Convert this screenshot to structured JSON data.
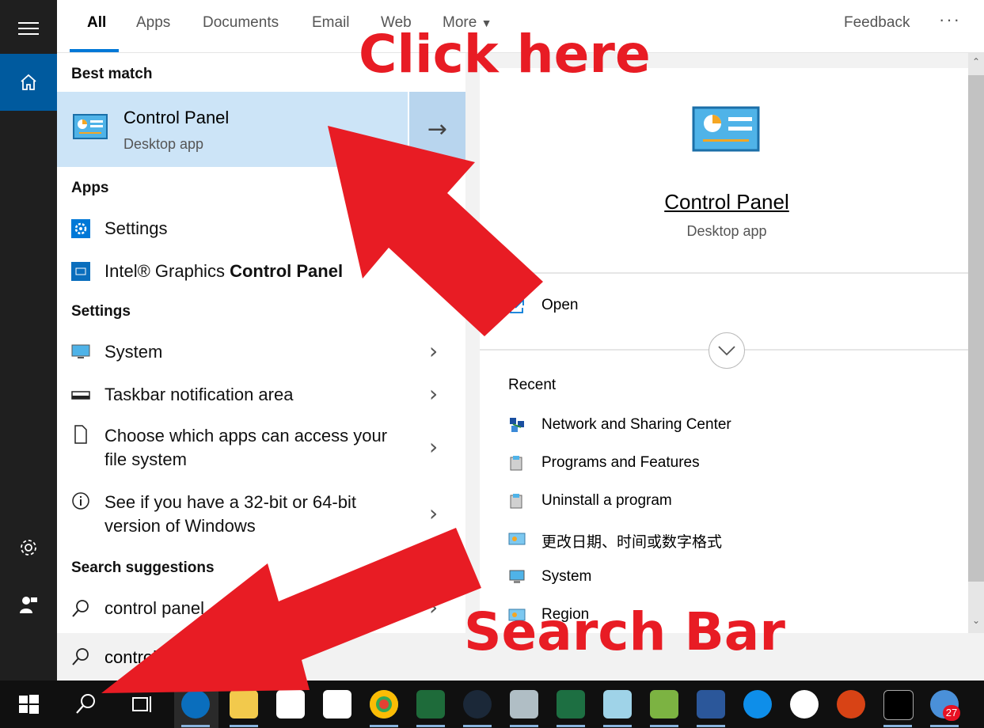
{
  "tabs": [
    {
      "label": "All",
      "active": true
    },
    {
      "label": "Apps"
    },
    {
      "label": "Documents"
    },
    {
      "label": "Email"
    },
    {
      "label": "Web"
    },
    {
      "label": "More"
    }
  ],
  "feedback_label": "Feedback",
  "more_options_label": "···",
  "sections": {
    "best_match": "Best match",
    "apps": "Apps",
    "settings": "Settings",
    "search_suggestions": "Search suggestions"
  },
  "best_match": {
    "title": "Control Panel",
    "subtitle": "Desktop app"
  },
  "apps": [
    {
      "label": "Settings"
    },
    {
      "label_prefix": "Intel® Graphics ",
      "label_bold": "Control Panel"
    }
  ],
  "settings_items": [
    {
      "line1": "System",
      "line2": ""
    },
    {
      "line1": "Taskbar notification area",
      "line2": ""
    },
    {
      "line1": "Choose which apps can access your",
      "line2": "file system"
    },
    {
      "line1": "See if you have a 32-bit or 64-bit",
      "line2": "version of Windows"
    }
  ],
  "suggestion": "control panel",
  "search_query": "control",
  "preview": {
    "title": "Control Panel",
    "subtitle": "Desktop app",
    "open_label": "Open",
    "recent_label": "Recent",
    "recent": [
      "Network and Sharing Center",
      "Programs and Features",
      "Uninstall a program",
      "更改日期、时间或数字格式",
      "System",
      "Region"
    ]
  },
  "annotations": {
    "click_here": "Click here",
    "search_bar": "Search Bar"
  },
  "taskbar_badge": "27",
  "colors": {
    "accent": "#0078d7",
    "highlight": "#cce4f7",
    "annotation_red": "#e81c24"
  }
}
